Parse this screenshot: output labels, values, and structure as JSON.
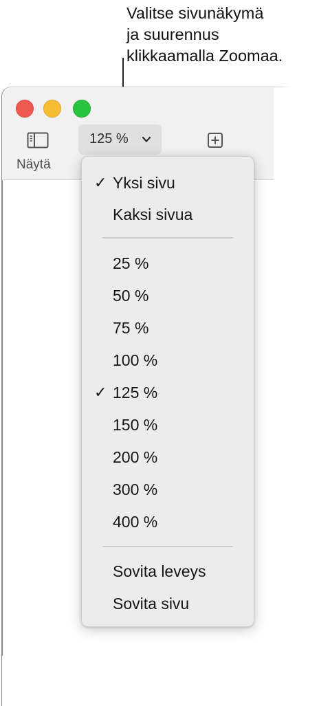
{
  "callout": {
    "text": "Valitse sivunäkymä\nja suurennus\nklikkaamalla Zoomaa."
  },
  "toolbar": {
    "view_label": "Näytä",
    "zoom_value": "125 %"
  },
  "menu": {
    "items": [
      {
        "label": "Yksi sivu",
        "checked": true
      },
      {
        "label": "Kaksi sivua",
        "checked": false
      },
      {
        "label": "25 %",
        "checked": false
      },
      {
        "label": "50 %",
        "checked": false
      },
      {
        "label": "75 %",
        "checked": false
      },
      {
        "label": "100 %",
        "checked": false
      },
      {
        "label": "125 %",
        "checked": true
      },
      {
        "label": "150 %",
        "checked": false
      },
      {
        "label": "200 %",
        "checked": false
      },
      {
        "label": "300 %",
        "checked": false
      },
      {
        "label": "400 %",
        "checked": false
      },
      {
        "label": "Sovita leveys",
        "checked": false
      },
      {
        "label": "Sovita sivu",
        "checked": false
      }
    ],
    "check_glyph": "✓"
  },
  "colors": {
    "close": "#ee5a52",
    "minimize": "#f6bd34",
    "zoom": "#28c43f"
  },
  "icons": {
    "view": "sidebar-icon",
    "zoom_dropdown": "chevron-down-icon",
    "add": "plus-square-icon"
  }
}
